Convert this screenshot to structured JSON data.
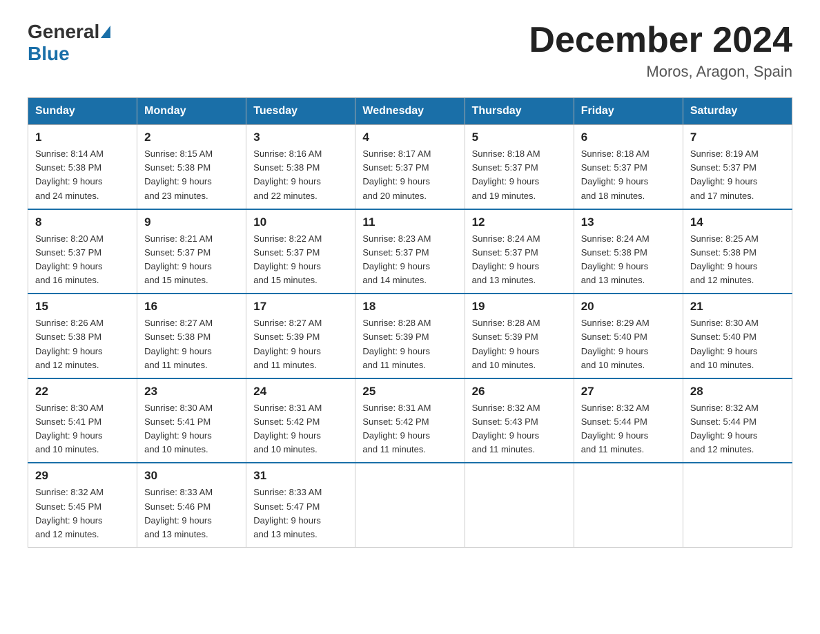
{
  "header": {
    "logo_general": "General",
    "logo_blue": "Blue",
    "month_title": "December 2024",
    "location": "Moros, Aragon, Spain"
  },
  "weekdays": [
    "Sunday",
    "Monday",
    "Tuesday",
    "Wednesday",
    "Thursday",
    "Friday",
    "Saturday"
  ],
  "weeks": [
    [
      {
        "day": "1",
        "sunrise": "8:14 AM",
        "sunset": "5:38 PM",
        "daylight": "9 hours and 24 minutes."
      },
      {
        "day": "2",
        "sunrise": "8:15 AM",
        "sunset": "5:38 PM",
        "daylight": "9 hours and 23 minutes."
      },
      {
        "day": "3",
        "sunrise": "8:16 AM",
        "sunset": "5:38 PM",
        "daylight": "9 hours and 22 minutes."
      },
      {
        "day": "4",
        "sunrise": "8:17 AM",
        "sunset": "5:37 PM",
        "daylight": "9 hours and 20 minutes."
      },
      {
        "day": "5",
        "sunrise": "8:18 AM",
        "sunset": "5:37 PM",
        "daylight": "9 hours and 19 minutes."
      },
      {
        "day": "6",
        "sunrise": "8:18 AM",
        "sunset": "5:37 PM",
        "daylight": "9 hours and 18 minutes."
      },
      {
        "day": "7",
        "sunrise": "8:19 AM",
        "sunset": "5:37 PM",
        "daylight": "9 hours and 17 minutes."
      }
    ],
    [
      {
        "day": "8",
        "sunrise": "8:20 AM",
        "sunset": "5:37 PM",
        "daylight": "9 hours and 16 minutes."
      },
      {
        "day": "9",
        "sunrise": "8:21 AM",
        "sunset": "5:37 PM",
        "daylight": "9 hours and 15 minutes."
      },
      {
        "day": "10",
        "sunrise": "8:22 AM",
        "sunset": "5:37 PM",
        "daylight": "9 hours and 15 minutes."
      },
      {
        "day": "11",
        "sunrise": "8:23 AM",
        "sunset": "5:37 PM",
        "daylight": "9 hours and 14 minutes."
      },
      {
        "day": "12",
        "sunrise": "8:24 AM",
        "sunset": "5:37 PM",
        "daylight": "9 hours and 13 minutes."
      },
      {
        "day": "13",
        "sunrise": "8:24 AM",
        "sunset": "5:38 PM",
        "daylight": "9 hours and 13 minutes."
      },
      {
        "day": "14",
        "sunrise": "8:25 AM",
        "sunset": "5:38 PM",
        "daylight": "9 hours and 12 minutes."
      }
    ],
    [
      {
        "day": "15",
        "sunrise": "8:26 AM",
        "sunset": "5:38 PM",
        "daylight": "9 hours and 12 minutes."
      },
      {
        "day": "16",
        "sunrise": "8:27 AM",
        "sunset": "5:38 PM",
        "daylight": "9 hours and 11 minutes."
      },
      {
        "day": "17",
        "sunrise": "8:27 AM",
        "sunset": "5:39 PM",
        "daylight": "9 hours and 11 minutes."
      },
      {
        "day": "18",
        "sunrise": "8:28 AM",
        "sunset": "5:39 PM",
        "daylight": "9 hours and 11 minutes."
      },
      {
        "day": "19",
        "sunrise": "8:28 AM",
        "sunset": "5:39 PM",
        "daylight": "9 hours and 10 minutes."
      },
      {
        "day": "20",
        "sunrise": "8:29 AM",
        "sunset": "5:40 PM",
        "daylight": "9 hours and 10 minutes."
      },
      {
        "day": "21",
        "sunrise": "8:30 AM",
        "sunset": "5:40 PM",
        "daylight": "9 hours and 10 minutes."
      }
    ],
    [
      {
        "day": "22",
        "sunrise": "8:30 AM",
        "sunset": "5:41 PM",
        "daylight": "9 hours and 10 minutes."
      },
      {
        "day": "23",
        "sunrise": "8:30 AM",
        "sunset": "5:41 PM",
        "daylight": "9 hours and 10 minutes."
      },
      {
        "day": "24",
        "sunrise": "8:31 AM",
        "sunset": "5:42 PM",
        "daylight": "9 hours and 10 minutes."
      },
      {
        "day": "25",
        "sunrise": "8:31 AM",
        "sunset": "5:42 PM",
        "daylight": "9 hours and 11 minutes."
      },
      {
        "day": "26",
        "sunrise": "8:32 AM",
        "sunset": "5:43 PM",
        "daylight": "9 hours and 11 minutes."
      },
      {
        "day": "27",
        "sunrise": "8:32 AM",
        "sunset": "5:44 PM",
        "daylight": "9 hours and 11 minutes."
      },
      {
        "day": "28",
        "sunrise": "8:32 AM",
        "sunset": "5:44 PM",
        "daylight": "9 hours and 12 minutes."
      }
    ],
    [
      {
        "day": "29",
        "sunrise": "8:32 AM",
        "sunset": "5:45 PM",
        "daylight": "9 hours and 12 minutes."
      },
      {
        "day": "30",
        "sunrise": "8:33 AM",
        "sunset": "5:46 PM",
        "daylight": "9 hours and 13 minutes."
      },
      {
        "day": "31",
        "sunrise": "8:33 AM",
        "sunset": "5:47 PM",
        "daylight": "9 hours and 13 minutes."
      },
      null,
      null,
      null,
      null
    ]
  ]
}
